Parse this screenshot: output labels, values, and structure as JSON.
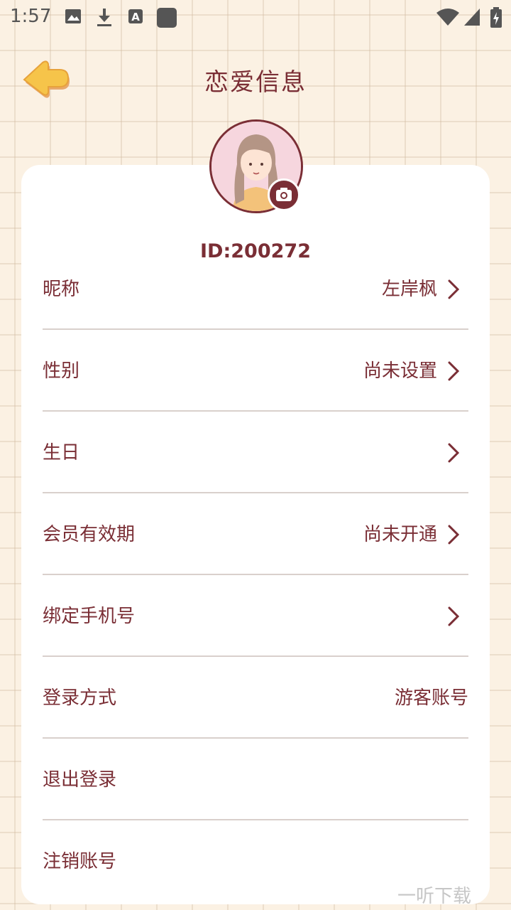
{
  "status_bar": {
    "time": "1:57",
    "icons": [
      "image-icon",
      "download-icon",
      "text-a-icon",
      "app-square-icon",
      "wifi-icon",
      "signal-icon",
      "battery-charging-icon"
    ]
  },
  "header": {
    "title": "恋爱信息",
    "back_icon": "back-arrow-icon"
  },
  "profile": {
    "id_text": "ID:200272",
    "camera_icon": "camera-icon"
  },
  "rows": [
    {
      "label": "昵称",
      "value": "左岸枫",
      "arrow": true
    },
    {
      "label": "性别",
      "value": "尚未设置",
      "arrow": true
    },
    {
      "label": "生日",
      "value": "",
      "arrow": true
    },
    {
      "label": "会员有效期",
      "value": "尚未开通",
      "arrow": true
    },
    {
      "label": "绑定手机号",
      "value": "",
      "arrow": true
    },
    {
      "label": "登录方式",
      "value": "游客账号",
      "arrow": false
    },
    {
      "label": "退出登录",
      "value": "",
      "arrow": false
    },
    {
      "label": "注销账号",
      "value": "",
      "arrow": false
    }
  ],
  "watermark": "一听下载",
  "colors": {
    "accent": "#7a2e35",
    "background": "#fbf1e3",
    "card": "#ffffff",
    "back_button": "#f6c44a"
  }
}
